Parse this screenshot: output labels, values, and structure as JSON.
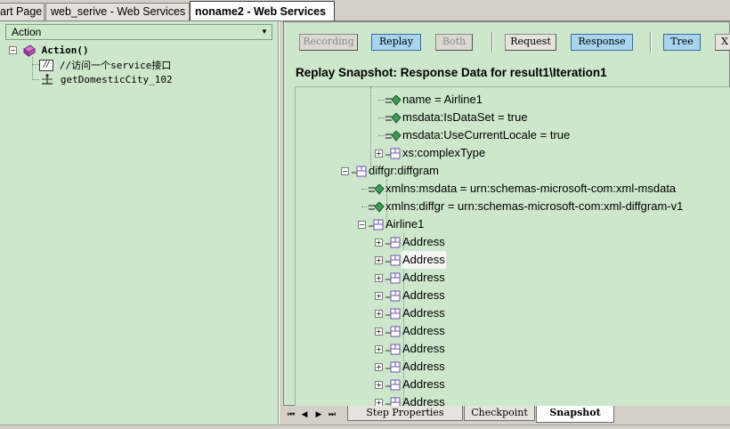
{
  "doc_tabs": [
    {
      "label": "Start Page",
      "shown": "art Page"
    },
    {
      "label": "web_serive - Web Services"
    },
    {
      "label": "noname2 - Web Services",
      "active": true
    }
  ],
  "left_panel": {
    "action_select": "Action",
    "tree": {
      "root": "Action()",
      "comment_label": "//",
      "comment": "//访问一个service接口",
      "step": "getDomesticCity_102"
    }
  },
  "toolbar": {
    "recording": "Recording",
    "replay": "Replay",
    "both": "Both",
    "request": "Request",
    "response": "Response",
    "tree": "Tree",
    "xml": "X"
  },
  "snapshot": {
    "title": "Replay Snapshot: Response Data for result1\\Iteration1"
  },
  "xml_tree": {
    "rows": [
      {
        "type": "attr",
        "text": "name = Airline1"
      },
      {
        "type": "attr",
        "text": "msdata:IsDataSet = true"
      },
      {
        "type": "attr",
        "text": "msdata:UseCurrentLocale = true"
      },
      {
        "type": "elem",
        "text": "xs:complexType",
        "expander": "+"
      },
      {
        "type": "elem",
        "text": "diffgr:diffgram",
        "expander": "-"
      },
      {
        "type": "attr",
        "text": "xmlns:msdata = urn:schemas-microsoft-com:xml-msdata"
      },
      {
        "type": "attr",
        "text": "xmlns:diffgr = urn:schemas-microsoft-com:xml-diffgram-v1"
      },
      {
        "type": "elem",
        "text": "Airline1",
        "expander": "-"
      },
      {
        "type": "elem",
        "text": "Address",
        "expander": "+"
      },
      {
        "type": "elem",
        "text": "Address",
        "expander": "+",
        "highlighted": true
      },
      {
        "type": "elem",
        "text": "Address",
        "expander": "+"
      },
      {
        "type": "elem",
        "text": "Address",
        "expander": "+"
      },
      {
        "type": "elem",
        "text": "Address",
        "expander": "+"
      },
      {
        "type": "elem",
        "text": "Address",
        "expander": "+"
      },
      {
        "type": "elem",
        "text": "Address",
        "expander": "+"
      },
      {
        "type": "elem",
        "text": "Address",
        "expander": "+"
      },
      {
        "type": "elem",
        "text": "Address",
        "expander": "+"
      },
      {
        "type": "elem",
        "text": "Address",
        "expander": "+"
      }
    ]
  },
  "bottom_tabs": {
    "nav_first": "⏮",
    "nav_prev": "◀",
    "nav_next": "▶",
    "nav_last": "⏭",
    "step_properties": "Step Properties",
    "checkpoint": "Checkpoint",
    "snapshot": "Snapshot"
  },
  "colors": {
    "panel_green": "#cde7cc",
    "chrome_gray": "#d4d0c8",
    "pressed_blue": "#a8d4ee",
    "attr_icon_green": "#3c9a54",
    "elem_icon_purple": "#7050b0"
  }
}
